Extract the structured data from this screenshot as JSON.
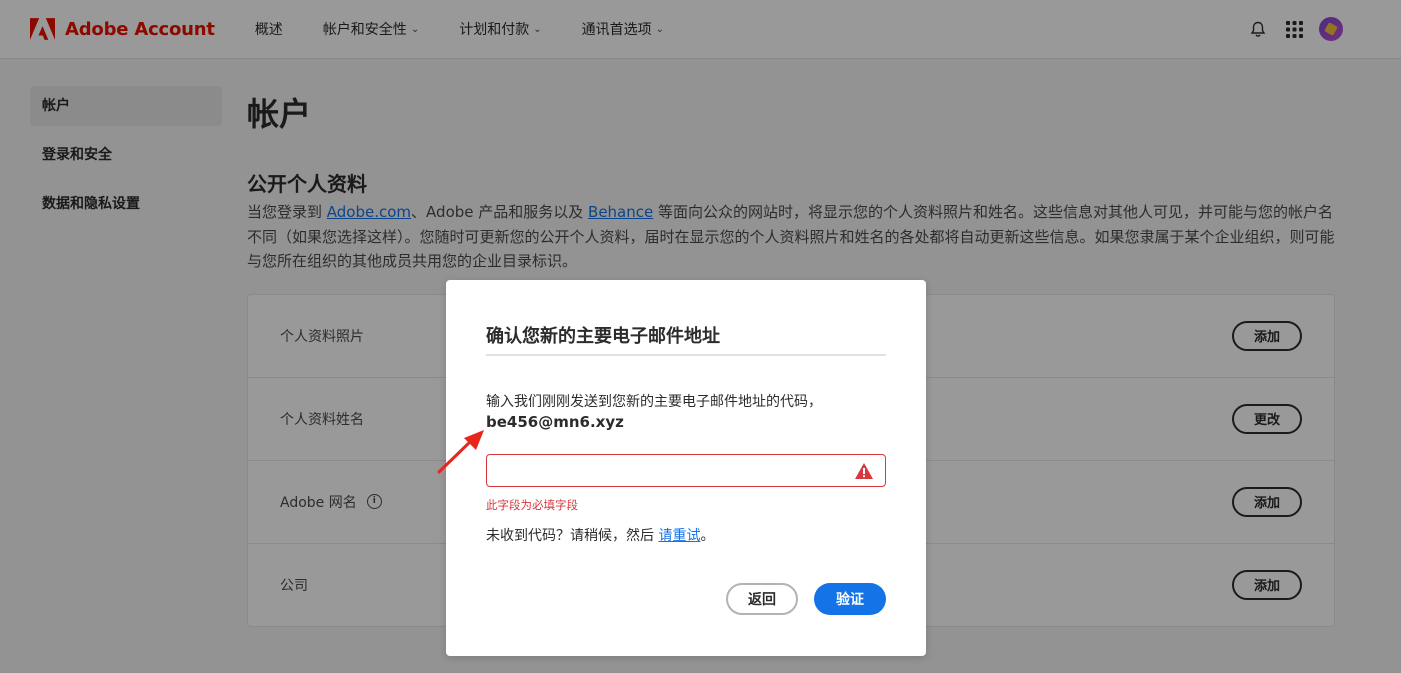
{
  "header": {
    "logo_text": "Adobe Account",
    "nav": [
      {
        "label": "概述",
        "has_dropdown": false
      },
      {
        "label": "帐户和安全性",
        "has_dropdown": true
      },
      {
        "label": "计划和付款",
        "has_dropdown": true
      },
      {
        "label": "通讯首选项",
        "has_dropdown": true
      }
    ],
    "icons": [
      "bell-icon",
      "apps-grid-icon",
      "avatar"
    ],
    "brand_color": "#eb1000"
  },
  "sidebar": {
    "items": [
      {
        "label": "帐户",
        "active": true
      },
      {
        "label": "登录和安全",
        "active": false
      },
      {
        "label": "数据和隐私设置",
        "active": false
      }
    ]
  },
  "main": {
    "title": "帐户",
    "section_title": "公开个人资料",
    "desc_part1": "当您登录到 ",
    "desc_link1": "Adobe.com",
    "desc_part2": "、Adobe 产品和服务以及 ",
    "desc_link2": "Behance",
    "desc_part3": " 等面向公众的网站时，将显示您的个人资料照片和姓名。这些信息对其他人可见，并可能与您的帐户名不同（如果您选择这样）。您随时可更新您的公开个人资料，届时在显示您的个人资料照片和姓名的各处都将自动更新这些信息。如果您隶属于某个企业组织，则可能与您所在组织的其他成员共用您的企业目录标识。",
    "rows": [
      {
        "label": "个人资料照片",
        "button": "添加",
        "info": false
      },
      {
        "label": "个人资料姓名",
        "button": "更改",
        "info": false
      },
      {
        "label": "Adobe 网名",
        "button": "添加",
        "info": true
      },
      {
        "label": "公司",
        "button": "添加",
        "info": false
      }
    ]
  },
  "modal": {
    "title": "确认您新的主要电子邮件地址",
    "instruction": "输入我们刚刚发送到您新的主要电子邮件地址的代码，",
    "email": "be456@mn6.xyz",
    "input_value": "",
    "error": "此字段为必填字段",
    "retry_prefix": "未收到代码？请稍候，然后 ",
    "retry_link": "请重试",
    "retry_suffix": "。",
    "back_label": "返回",
    "verify_label": "验证",
    "accent_color": "#1473e6",
    "error_color": "#d7373f"
  },
  "annotation": {
    "color": "#e8261b",
    "icon": "red-arrow-icon"
  }
}
